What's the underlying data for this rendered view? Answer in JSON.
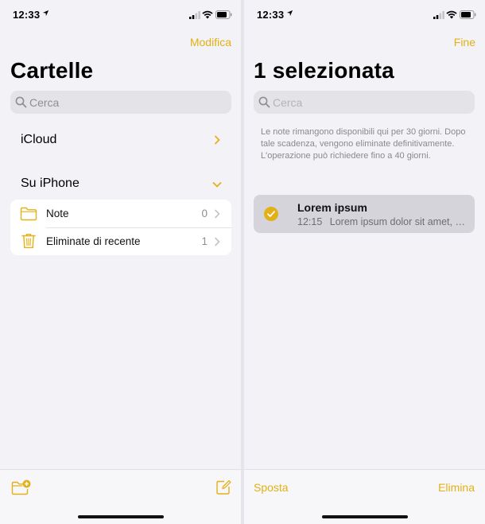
{
  "colors": {
    "accent": "#e3b017",
    "background": "#f2f2f7",
    "secondary_text": "#8e8e93"
  },
  "left": {
    "status": {
      "time": "12:33"
    },
    "nav": {
      "action": "Modifica"
    },
    "title": "Cartelle",
    "search": {
      "placeholder": "Cerca"
    },
    "groups": {
      "icloud": {
        "label": "iCloud",
        "chevron": "chevron-right-icon"
      },
      "on_iphone": {
        "label": "Su iPhone",
        "chevron": "chevron-down-icon"
      }
    },
    "folders": [
      {
        "label": "Note",
        "count": "0",
        "icon": "folder-icon"
      },
      {
        "label": "Eliminate di recente",
        "count": "1",
        "icon": "trash-icon"
      }
    ],
    "toolbar": {
      "new_folder_icon": "new-folder-icon",
      "compose_icon": "compose-icon"
    }
  },
  "right": {
    "status": {
      "time": "12:33"
    },
    "nav": {
      "action": "Fine"
    },
    "title": "1 selezionata",
    "search": {
      "placeholder": "Cerca"
    },
    "info_text": "Le note rimangono disponibili qui per 30 giorni. Dopo tale scadenza, vengono eliminate definitivamente. L'operazione può richiedere fino a 40 giorni.",
    "note": {
      "title": "Lorem ipsum",
      "time": "12:15",
      "preview": "Lorem ipsum dolor sit amet, consectetur",
      "selected": true
    },
    "toolbar": {
      "move_label": "Sposta",
      "delete_label": "Elimina"
    }
  }
}
